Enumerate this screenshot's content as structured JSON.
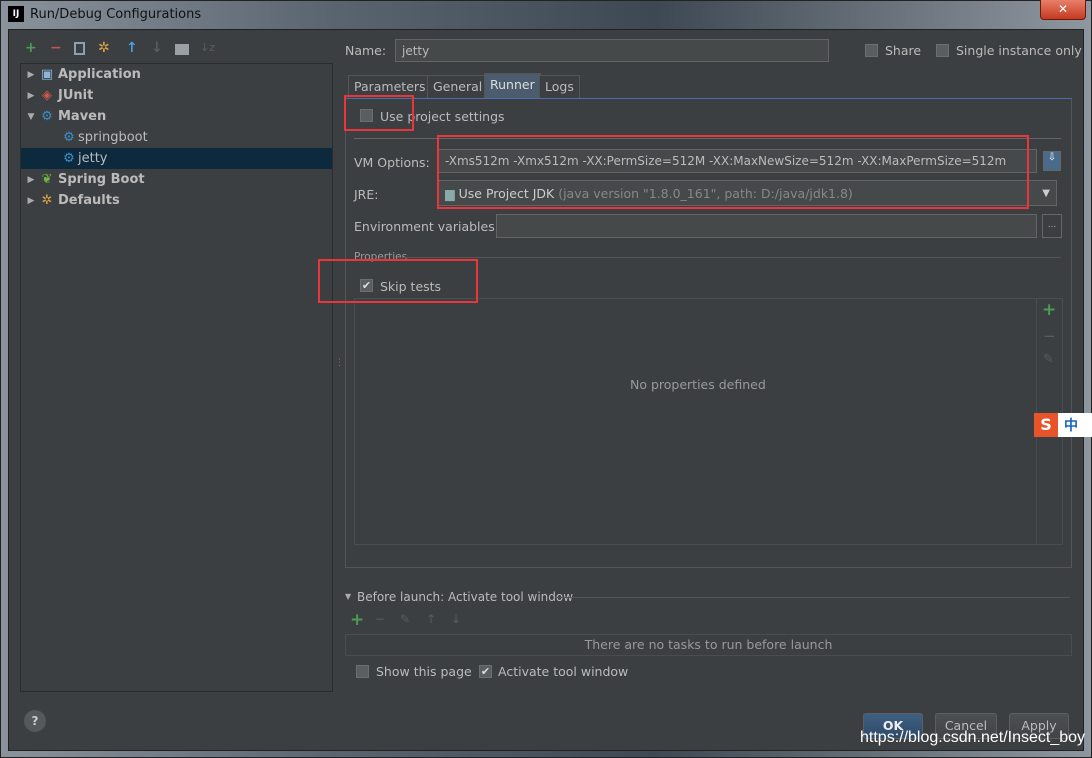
{
  "window": {
    "title": "Run/Debug Configurations",
    "app_icon": "IJ",
    "close": "✕"
  },
  "toolbar": {
    "add": "+",
    "remove": "−",
    "copy": "copy-icon",
    "edit_defaults": "wrench-icon",
    "move_up": "↑",
    "move_down": "↓",
    "folder": "folder-icon",
    "sort": "sort-icon"
  },
  "tree": [
    {
      "label": "Application",
      "expanded": false
    },
    {
      "label": "JUnit",
      "expanded": false
    },
    {
      "label": "Maven",
      "expanded": true
    },
    {
      "label": "springboot"
    },
    {
      "label": "jetty",
      "selected": true
    },
    {
      "label": "Spring Boot",
      "expanded": false
    },
    {
      "label": "Defaults",
      "expanded": false
    }
  ],
  "form": {
    "name_label": "Name:",
    "name_value": "jetty",
    "share_label": "Share",
    "share_checked": false,
    "single_instance_label": "Single instance only",
    "single_instance_checked": false,
    "tabs": [
      "Parameters",
      "General",
      "Runner",
      "Logs"
    ],
    "active_tab": "Runner",
    "use_project_settings_label": "Use project settings",
    "use_project_settings_checked": false,
    "vm_options_label": "VM Options:",
    "vm_options_value": "-Xms512m -Xmx512m -XX:PermSize=512M -XX:MaxNewSize=512m -XX:MaxPermSize=512m",
    "jre_label": "JRE:",
    "jre_value": "Use Project JDK",
    "jre_detail": "(java version \"1.8.0_161\", path: D:/java/jdk1.8)",
    "env_label": "Environment variables:",
    "env_value": "",
    "env_button": "...",
    "properties_label": "Properties",
    "skip_tests_label": "Skip tests",
    "skip_tests_checked": true,
    "no_properties": "No properties defined"
  },
  "before_launch": {
    "header": "Before launch: Activate tool window",
    "empty": "There are no tasks to run before launch",
    "show_page_label": "Show this page",
    "show_page_checked": false,
    "activate_label": "Activate tool window",
    "activate_checked": true
  },
  "buttons": {
    "help": "?",
    "ok": "OK",
    "cancel": "Cancel",
    "apply": "Apply"
  },
  "watermark": "https://blog.csdn.net/Insect_boy",
  "ime": {
    "logo": "S",
    "text": "中"
  }
}
